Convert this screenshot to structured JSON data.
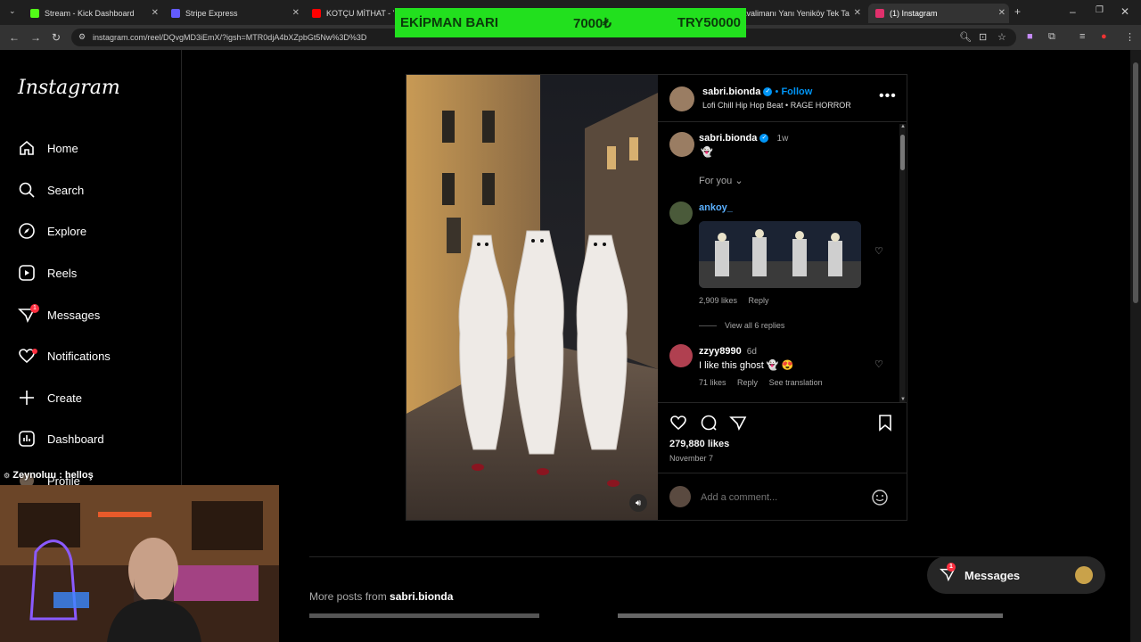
{
  "browser": {
    "tabs": [
      {
        "title": "Stream - Kick Dashboard",
        "color": "#53fc18"
      },
      {
        "title": "Stripe Express",
        "color": "#635bff"
      },
      {
        "title": "KOTÇU MİTHAT - You",
        "color": "#ff0000"
      },
      {
        "title": "Havalimanı Yanı Yeniköy Tek Ta",
        "color": "#4caf50"
      },
      {
        "title": "(1) Instagram",
        "color": "#e1306c"
      }
    ],
    "url": "instagram.com/reel/DQvgMD3iEmX/?igsh=MTR0djA4bXZpbGt5Nw%3D%3D"
  },
  "overlay": {
    "label": "EKİPMAN BARI",
    "amount": "7000₺",
    "goal": "TRY50000",
    "color": "#22e01e"
  },
  "sidebar": {
    "logo": "Instagram",
    "items": [
      {
        "label": "Home",
        "icon": "home-icon"
      },
      {
        "label": "Search",
        "icon": "search-icon"
      },
      {
        "label": "Explore",
        "icon": "compass-icon"
      },
      {
        "label": "Reels",
        "icon": "reels-icon"
      },
      {
        "label": "Messages",
        "icon": "messenger-icon",
        "badge": "1"
      },
      {
        "label": "Notifications",
        "icon": "heart-icon"
      },
      {
        "label": "Create",
        "icon": "plus-icon"
      },
      {
        "label": "Dashboard",
        "icon": "dashboard-icon"
      },
      {
        "label": "Profile",
        "icon": "profile-icon"
      }
    ]
  },
  "chat_overlay": {
    "user": "Zeynoluu",
    "message": ": helloş"
  },
  "post": {
    "author": "sabri.bionda",
    "follow": "Follow",
    "separator": "•",
    "audio": "Lofi Chill Hip Hop Beat • RAGE HORROR",
    "caption_author": "sabri.bionda",
    "caption_time": "1w",
    "caption_text": "👻",
    "for_you": "For you",
    "comments": [
      {
        "user": "ankoy_",
        "likes": "2,909 likes",
        "reply": "Reply",
        "view_replies": "View all 6 replies"
      },
      {
        "user": "zzyy8990",
        "time": "6d",
        "text": "I like this ghost 👻 😍",
        "likes": "71 likes",
        "reply": "Reply",
        "translate": "See translation"
      }
    ],
    "likes": "279,880 likes",
    "date": "November 7",
    "comment_placeholder": "Add a comment..."
  },
  "more_posts": {
    "prefix": "More posts from",
    "user": "sabri.bionda"
  },
  "messages_bar": {
    "label": "Messages",
    "badge": "1"
  }
}
